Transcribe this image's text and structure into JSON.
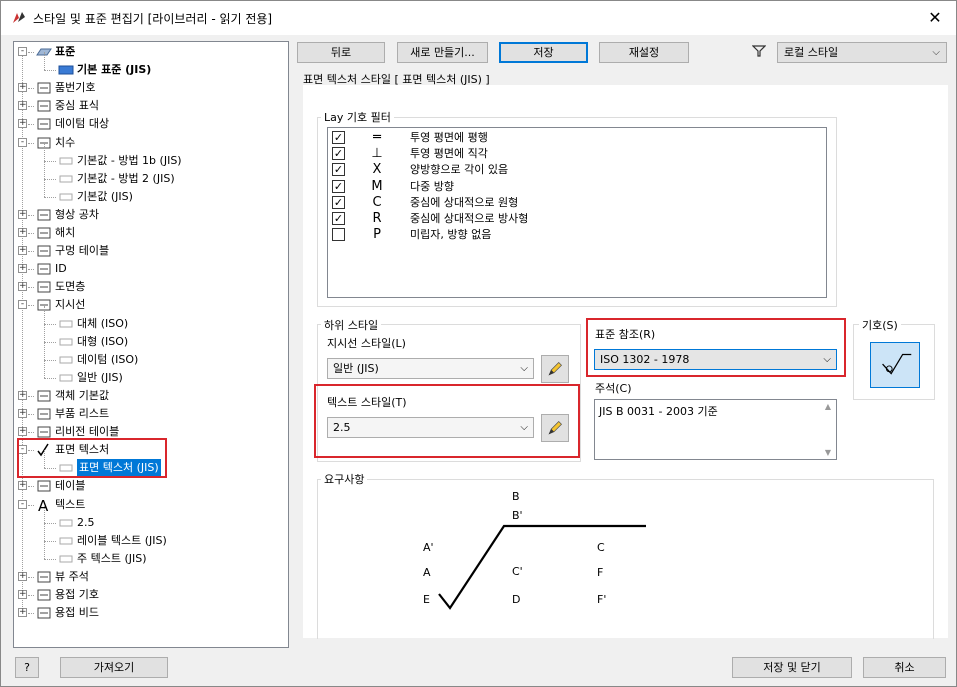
{
  "window": {
    "title": "스타일 및 표준 편집기 [라이브러리 - 읽기 전용]",
    "close_glyph": "✕"
  },
  "tree": {
    "items": [
      {
        "label": "표준",
        "icon": "standard-icon"
      },
      {
        "label": "기본 표준 (JIS)",
        "icon": "standard-doc-icon"
      },
      {
        "label": "품번기호",
        "icon": "balloon-icon"
      },
      {
        "label": "중심 표식",
        "icon": "center-mark-icon"
      },
      {
        "label": "데이텀 대상",
        "icon": "datum-target-icon"
      },
      {
        "label": "치수",
        "icon": "dimension-icon"
      },
      {
        "label": "기본값 - 방법 1b (JIS)",
        "icon": "style-icon"
      },
      {
        "label": "기본값 - 방법 2 (JIS)",
        "icon": "style-icon"
      },
      {
        "label": "기본값 (JIS)",
        "icon": "style-icon"
      },
      {
        "label": "형상 공차",
        "icon": "feature-control-frame-icon"
      },
      {
        "label": "해치",
        "icon": "hatch-icon"
      },
      {
        "label": "구멍 테이블",
        "icon": "hole-table-icon"
      },
      {
        "label": "ID",
        "icon": "id-icon"
      },
      {
        "label": "도면층",
        "icon": "layers-icon"
      },
      {
        "label": "지시선",
        "icon": "leader-icon"
      },
      {
        "label": "대체 (ISO)",
        "icon": "style-icon"
      },
      {
        "label": "대형 (ISO)",
        "icon": "style-icon"
      },
      {
        "label": "데이텀 (ISO)",
        "icon": "style-icon"
      },
      {
        "label": "일반 (JIS)",
        "icon": "style-icon"
      },
      {
        "label": "객체 기본값",
        "icon": "object-defaults-icon"
      },
      {
        "label": "부품 리스트",
        "icon": "parts-list-icon"
      },
      {
        "label": "리비전 테이블",
        "icon": "revision-table-icon"
      },
      {
        "label": "표면 텍스처",
        "icon": "surface-texture-icon"
      },
      {
        "label": "표면 텍스처 (JIS)",
        "icon": "style-icon"
      },
      {
        "label": "테이블",
        "icon": "table-icon"
      },
      {
        "label": "텍스트",
        "icon": "text-icon"
      },
      {
        "label": "2.5",
        "icon": "style-icon"
      },
      {
        "label": "레이블 텍스트 (JIS)",
        "icon": "style-icon"
      },
      {
        "label": "주 텍스트 (JIS)",
        "icon": "style-icon"
      },
      {
        "label": "뷰 주석",
        "icon": "view-annotation-icon"
      },
      {
        "label": "용접 기호",
        "icon": "weld-symbol-icon"
      },
      {
        "label": "용접 비드",
        "icon": "weld-bead-icon"
      }
    ]
  },
  "toolbar": {
    "back": "뒤로",
    "new": "새로 만들기...",
    "save": "저장",
    "reset": "재설정",
    "filter_icon": "filter-icon",
    "filter_value": "로컬 스타일"
  },
  "panel": {
    "header": "표면 텍스처 스타일 [ 표면 텍스처 (JIS) ]",
    "lay_filter": {
      "title": "Lay 기호 필터",
      "rows": [
        {
          "checked": true,
          "symbol": "═",
          "label": "투영 평면에 평행"
        },
        {
          "checked": true,
          "symbol": "⊥",
          "label": "투영 평면에 직각"
        },
        {
          "checked": true,
          "symbol": "X",
          "label": "양방향으로 각이 있음"
        },
        {
          "checked": true,
          "symbol": "M",
          "label": "다중 방향"
        },
        {
          "checked": true,
          "symbol": "C",
          "label": "중심에 상대적으로 원형"
        },
        {
          "checked": true,
          "symbol": "R",
          "label": "중심에 상대적으로 방사형"
        },
        {
          "checked": false,
          "symbol": "P",
          "label": "미립자, 방향 없음"
        }
      ],
      "check_glyph": "✓"
    },
    "sub_style": {
      "title": "하위 스타일",
      "leader_label": "지시선 스타일(L)",
      "leader_value": "일반 (JIS)",
      "text_label": "텍스트 스타일(T)",
      "text_value": "2.5"
    },
    "standard_ref": {
      "label": "표준 참조(R)",
      "value": "ISO 1302 - 1978",
      "notes_label": "주석(C)",
      "notes_value": "JIS B 0031 - 2003 기준"
    },
    "symbol": {
      "label": "기호(S)"
    },
    "requirements": {
      "title": "요구사항",
      "labels": [
        "B",
        "B'",
        "A'",
        "A",
        "E",
        "C'",
        "D",
        "C",
        "F",
        "F'"
      ]
    }
  },
  "footer": {
    "help": "?",
    "import": "가져오기",
    "save_close": "저장 및 닫기",
    "cancel": "취소"
  },
  "colors": {
    "highlight": "#d9262c",
    "selection": "#0078d7"
  }
}
